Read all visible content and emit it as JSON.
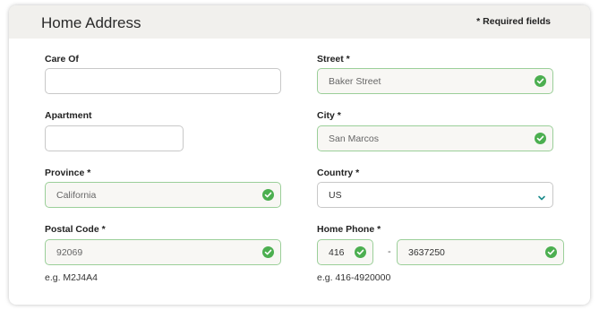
{
  "header": {
    "title": "Home Address",
    "required_note": "* Required fields"
  },
  "fields": {
    "care_of": {
      "label": "Care Of",
      "value": ""
    },
    "street": {
      "label": "Street *",
      "value": "Baker Street"
    },
    "apartment": {
      "label": "Apartment",
      "value": ""
    },
    "city": {
      "label": "City *",
      "value": "San Marcos"
    },
    "province": {
      "label": "Province *",
      "value": "California"
    },
    "country": {
      "label": "Country *",
      "value": "US"
    },
    "postal_code": {
      "label": "Postal Code *",
      "value": "92069",
      "hint": "e.g. M2J4A4"
    },
    "home_phone": {
      "label": "Home Phone *",
      "area_code": "416",
      "separator": "-",
      "number": "3637250",
      "hint": "e.g. 416-4920000"
    }
  },
  "icons": {
    "valid": "check-circle-icon",
    "dropdown": "chevron-down-icon"
  },
  "colors": {
    "valid_green": "#4caf50",
    "accent_teal": "#1c8c8c"
  }
}
